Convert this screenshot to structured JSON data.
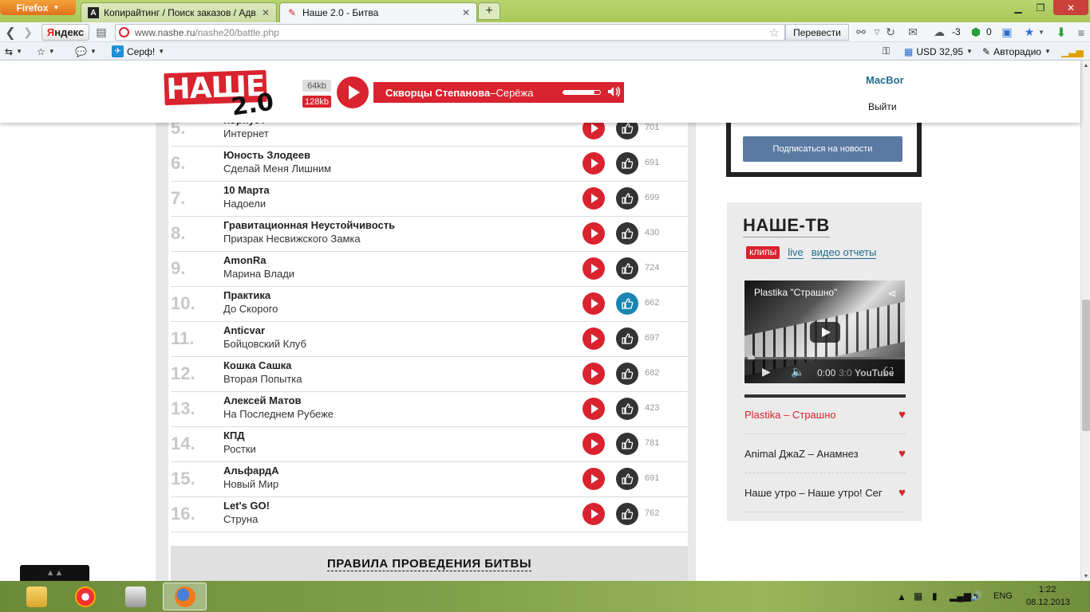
{
  "browser": {
    "menu_label": "Firefox",
    "tabs": [
      {
        "label": "Копирайтинг / Поиск заказов / Адв..."
      },
      {
        "label": "Наше 2.0 - Битва"
      }
    ],
    "new_tab": "+",
    "url_domain": "www.nashe.ru",
    "url_path": "/nashe20/battle.php",
    "yandex": {
      "y": "Я",
      "rest": "ндекс"
    },
    "translate_label": "Перевести",
    "weather": "-3",
    "counter": "0",
    "bookmarks": {
      "surf": "Серф!",
      "surf_icon": "✈"
    },
    "currency": "USD 32,95",
    "radio": "Авторадио"
  },
  "site": {
    "logo_text": "НАШЕ",
    "logo_version": "2.0",
    "bitrate_low": "64kb",
    "bitrate_high": "128kb",
    "now_playing": {
      "artist": "Скворцы Степанова",
      "separator": " – ",
      "song": "Серёжа"
    },
    "volume": 0.85,
    "user_name": "MacBor",
    "logout": "Выйти",
    "accent_color": "#d9232e"
  },
  "battle": {
    "rows": [
      {
        "num": "5.",
        "artist": "Корнуэ?",
        "song": "Интернет",
        "votes": "701",
        "voted": false
      },
      {
        "num": "6.",
        "artist": "Юность Злодеев",
        "song": "Сделай Меня Лишним",
        "votes": "691",
        "voted": false
      },
      {
        "num": "7.",
        "artist": "10 Марта",
        "song": "Надоели",
        "votes": "699",
        "voted": false
      },
      {
        "num": "8.",
        "artist": "Гравитационная Неустойчивость",
        "song": "Призрак Несвижского Замка",
        "votes": "430",
        "voted": false
      },
      {
        "num": "9.",
        "artist": "AmonRa",
        "song": "Марина Влади",
        "votes": "724",
        "voted": false
      },
      {
        "num": "10.",
        "artist": "Практика",
        "song": "До Скорого",
        "votes": "662",
        "voted": true
      },
      {
        "num": "11.",
        "artist": "Anticvar",
        "song": "Бойцовский Клуб",
        "votes": "697",
        "voted": false
      },
      {
        "num": "12.",
        "artist": "Кошка Сашка",
        "song": "Вторая Попытка",
        "votes": "682",
        "voted": false
      },
      {
        "num": "13.",
        "artist": "Алексей Матов",
        "song": "На Последнем Рубеже",
        "votes": "423",
        "voted": false
      },
      {
        "num": "14.",
        "artist": "КПД",
        "song": "Ростки",
        "votes": "781",
        "voted": false
      },
      {
        "num": "15.",
        "artist": "АльфардА",
        "song": "Новый Мир",
        "votes": "691",
        "voted": false
      },
      {
        "num": "16.",
        "artist": "Let's GO!",
        "song": "Струна",
        "votes": "762",
        "voted": false
      }
    ],
    "rules_title": "ПРАВИЛА ПРОВЕДЕНИЯ БИТВЫ"
  },
  "sidebar": {
    "subscribe_label": "Подписаться на новости",
    "tv_title": "НАШЕ-ТВ",
    "tv_tabs": [
      {
        "label": "клипы",
        "active": true
      },
      {
        "label": "live",
        "active": false
      },
      {
        "label": "видео отчеты",
        "active": false
      }
    ],
    "video": {
      "title": "Plastika \"Страшно\"",
      "time": "0:00",
      "duration_fragment": "3:0",
      "yt_logo": "YouTube"
    },
    "playlist": [
      {
        "label": "Plastika – Страшно",
        "current": true
      },
      {
        "label": "Animal ДжаZ – Анамнез",
        "current": false
      },
      {
        "label": "Наше утро – Наше утро! Сег",
        "current": false
      }
    ]
  },
  "taskbar": {
    "lang": "ENG",
    "time": "1:22",
    "date": "08.12.2013"
  }
}
